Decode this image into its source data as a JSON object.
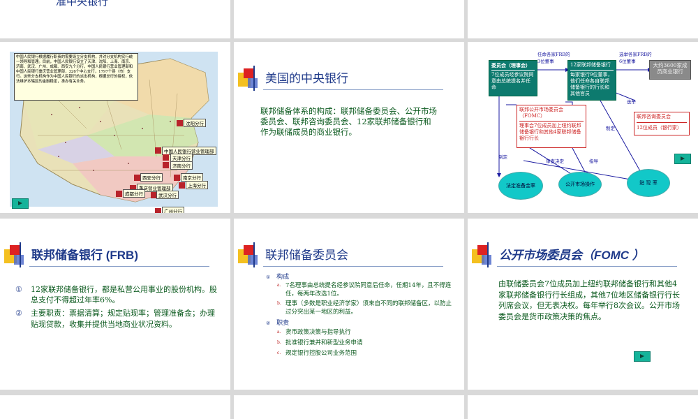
{
  "top_row": {
    "partial_title": "准中央银行"
  },
  "slide_map": {
    "description_text": "中国人民银行根据履行职责的需要设立分支机构，并对分支机构实行统一领导和管理。目前，中国人民银行设立了天津、沈阳、上海、南京、济南、武汉、广州、成都、西安九个分行，中国人民银行营业管理部和中国人民银行重庆营业管理部，326个中心支行，1797个县（市）支行。这些分支机构作为中国人民银行的派出机构，根据总行的授权，依法维护本辖区的金融稳定，承办有关业务。",
    "branches": [
      "沈阳分行",
      "中国人民银行营业管理部",
      "天津分行",
      "济南分行",
      "西安分行",
      "南京分行",
      "重庆营业管理部",
      "上海分行",
      "成都分行",
      "武汉分行",
      "广州分行"
    ]
  },
  "slide_us": {
    "title": "美国的中央银行",
    "body": "联邦储备体系的构成：联邦储备委员会、公开市场委员会、联邦咨询委员会、12家联邦储备银行和作为联储成员的商业银行。"
  },
  "slide_chart": {
    "board_title": "委员会（理事会）",
    "board_body": "7位成员经参议院同意由总统提名并任命",
    "frb_title": "12家联邦储备银行",
    "frb_body": "每家银行9位董事，他们任命各自联邦储备银行的行长和其他官员",
    "banks_body": "大约3600家成员商业银行",
    "fomc_title": "联邦公开市场委员会（FOMC）",
    "fomc_body": "理事会7位成员加上纽约联邦储备银行和其他4家联邦储备银行行长",
    "advisory_title": "联邦咨询委员会",
    "advisory_body": "12位成员（银行家）",
    "label_appoint3": "任命各家FRB的3位董事",
    "label_elect6": "选举各家FRB的6位董事",
    "label_elect": "选举",
    "label_set1": "制定",
    "label_set2": "制定",
    "label_review": "审查决定",
    "label_guide": "指导",
    "node_reserve": "法定准备金率",
    "node_omo": "公开市场操作",
    "node_discount": "贴 现 率"
  },
  "slide_frb": {
    "title": "联邦储备银行 (FRB)",
    "items": [
      {
        "bullet": "①",
        "text": "12家联邦储备银行，都是私营公用事业的股份机构。股息支付不得超过年率6%。"
      },
      {
        "bullet": "②",
        "text": "主要职责：票据清算；规定贴现率；管理准备金；办理贴现贷款，收集并提供当地商业状况资料。"
      }
    ]
  },
  "slide_board": {
    "title": "联邦储备委员会",
    "section1": {
      "bullet": "①",
      "label": "构成"
    },
    "section1_items": [
      {
        "bullet": "a.",
        "text": "7名理事由总统提名经参议院同意后任命，任期14年，且不得连任，每两年改选1位。"
      },
      {
        "bullet": "b.",
        "text": "理事（多数是职业经济学家）须来自不同的联邦储备区，以防止过分突出某一地区的利益。"
      }
    ],
    "section2": {
      "bullet": "②",
      "label": "职责"
    },
    "section2_items": [
      {
        "bullet": "a.",
        "text": "货币政策决策与指导执行"
      },
      {
        "bullet": "b.",
        "text": "批准银行兼并和新型业务申请"
      },
      {
        "bullet": "c.",
        "text": "规定银行控股公司业务范围"
      }
    ]
  },
  "slide_fomc": {
    "title": "公开市场委员会（FOMC ）",
    "body": "由联储委员会7位成员加上纽约联邦储备银行和其他4家联邦储备银行行长组成，其他7位地区储备银行行长列席会议，但无表决权。每年举行8次会议。公开市场委员会是货币政策决策的焦点。"
  }
}
